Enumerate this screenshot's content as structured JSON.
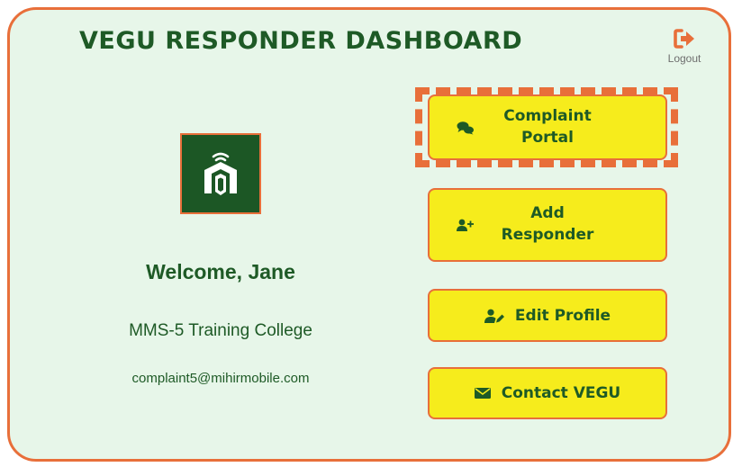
{
  "header": {
    "title": "VEGU RESPONDER DASHBOARD",
    "logout_label": "Logout",
    "logout_icon": "sign-out-icon"
  },
  "profile": {
    "logo": "vegu-logo",
    "welcome": "Welcome, Jane",
    "organization": "MMS-5 Training College",
    "email": "complaint5@mihirmobile.com"
  },
  "actions": [
    {
      "line1": "Complaint",
      "line2": "Portal",
      "icon": "comments-icon",
      "highlighted": true
    },
    {
      "line1": "Add",
      "line2": "Responder",
      "icon": "user-plus-icon"
    },
    {
      "label": "Edit Profile",
      "icon": "user-edit-icon"
    },
    {
      "label": "Contact VEGU",
      "icon": "envelope-icon"
    }
  ],
  "colors": {
    "background": "#e7f6e9",
    "border_accent": "#e86f3a",
    "brand_green": "#1e5a26",
    "button_yellow": "#f6ec1c"
  }
}
